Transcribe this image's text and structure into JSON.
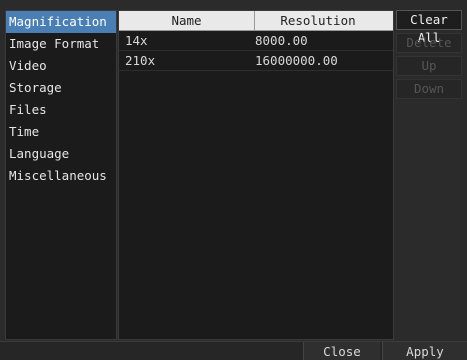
{
  "sidebar": {
    "items": [
      {
        "label": "Magnification"
      },
      {
        "label": "Image Format"
      },
      {
        "label": "Video"
      },
      {
        "label": "Storage"
      },
      {
        "label": "Files"
      },
      {
        "label": "Time"
      },
      {
        "label": "Language"
      },
      {
        "label": "Miscellaneous"
      }
    ]
  },
  "table": {
    "columns": [
      "Name",
      "Resolution"
    ],
    "rows": [
      {
        "name": "14x",
        "resolution": "8000.00"
      },
      {
        "name": "210x",
        "resolution": "16000000.00"
      }
    ]
  },
  "actions": {
    "clear_all": "Clear All",
    "delete": "Delete",
    "up": "Up",
    "down": "Down"
  },
  "footer": {
    "close": "Close",
    "apply": "Apply"
  },
  "colors": {
    "selected": "#4a7fb6",
    "header_bg": "#e9e9e9",
    "panel_bg": "#1b1b1b",
    "window_bg": "#2b2b2b"
  }
}
